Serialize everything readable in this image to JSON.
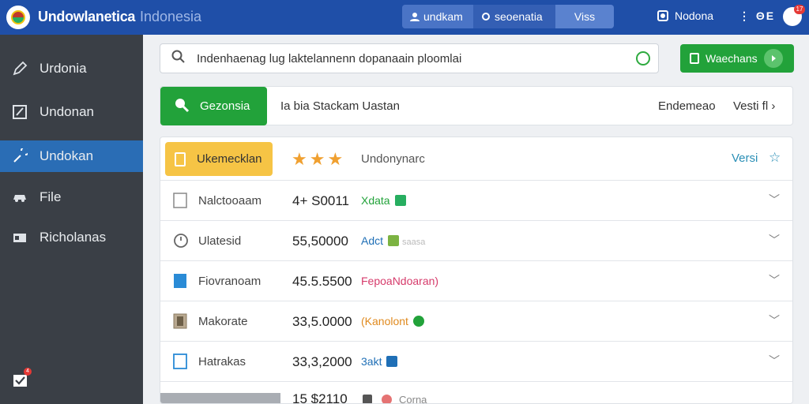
{
  "header": {
    "title": "Undowlanetica",
    "subtitle": "Indonesia",
    "segments": [
      "undkam",
      "seoenatia",
      "Viss"
    ],
    "user_name": "Nodona",
    "grid_label": "⋮ ΘE",
    "avatar_badge": "17"
  },
  "sidebar": {
    "items": [
      {
        "label": "Urdonia",
        "icon": "pen-icon"
      },
      {
        "label": "Undonan",
        "icon": "document-icon"
      },
      {
        "label": "Undokan",
        "icon": "wrench-icon",
        "active": true
      },
      {
        "label": "File",
        "icon": "car-icon"
      },
      {
        "label": "Richolanas",
        "icon": "id-card-icon"
      }
    ],
    "bottom_badge": "4"
  },
  "search": {
    "value": "Indenhaenag lug laktelannenn dopanaain ploomlai"
  },
  "top_button": {
    "label": "Waechans"
  },
  "toolbar": {
    "button_label": "Gezonsia",
    "label": "Ia bia Stackam Uastan",
    "right_label": "Endemeao",
    "right_label_2": "Vesti fl ›"
  },
  "table": {
    "header": {
      "chip_label": "Ukemecklan",
      "stars": "★★★",
      "column": "Undonynarc",
      "versi": "Versi",
      "versi_star": "☆"
    },
    "rows": [
      {
        "name": "Nalctooaam",
        "value": "4+ S0011",
        "tag": "Xdata",
        "tag_color": "#22a23a",
        "tag_icon_color": "#27ae60",
        "icon": "checkbox-icon",
        "extra": ""
      },
      {
        "name": "Ulatesid",
        "value": "55,50000",
        "tag": "Adct",
        "tag_color": "#1f6fb6",
        "tag_icon_color": "#7cb342",
        "icon": "clock-icon",
        "extra": "saasa"
      },
      {
        "name": "Fiovranoam",
        "value": "45.5.5500",
        "tag": "FepoaNdoaran)",
        "tag_color": "#d63b6b",
        "tag_icon_color": "",
        "icon": "square-blue-icon",
        "extra": ""
      },
      {
        "name": "Makorate",
        "value": "33,5.0000",
        "tag": "(Kanolont",
        "tag_color": "#e08a1e",
        "tag_icon_color": "#22a23a",
        "icon": "book-icon",
        "extra": ""
      },
      {
        "name": "Hatrakas",
        "value": "33,3,2000",
        "tag": "3akt",
        "tag_color": "#1f6fb6",
        "tag_icon_color": "#1f6fb6",
        "icon": "tablet-icon",
        "extra": ""
      }
    ],
    "last_row": {
      "value": "15 $2110",
      "tag": "Corna"
    }
  },
  "colors": {
    "topbar": "#1f4fa8",
    "sidebar": "#3a3f46",
    "sidebar_active": "#2a6db5",
    "green": "#22a23a",
    "yellow": "#f6c445"
  }
}
